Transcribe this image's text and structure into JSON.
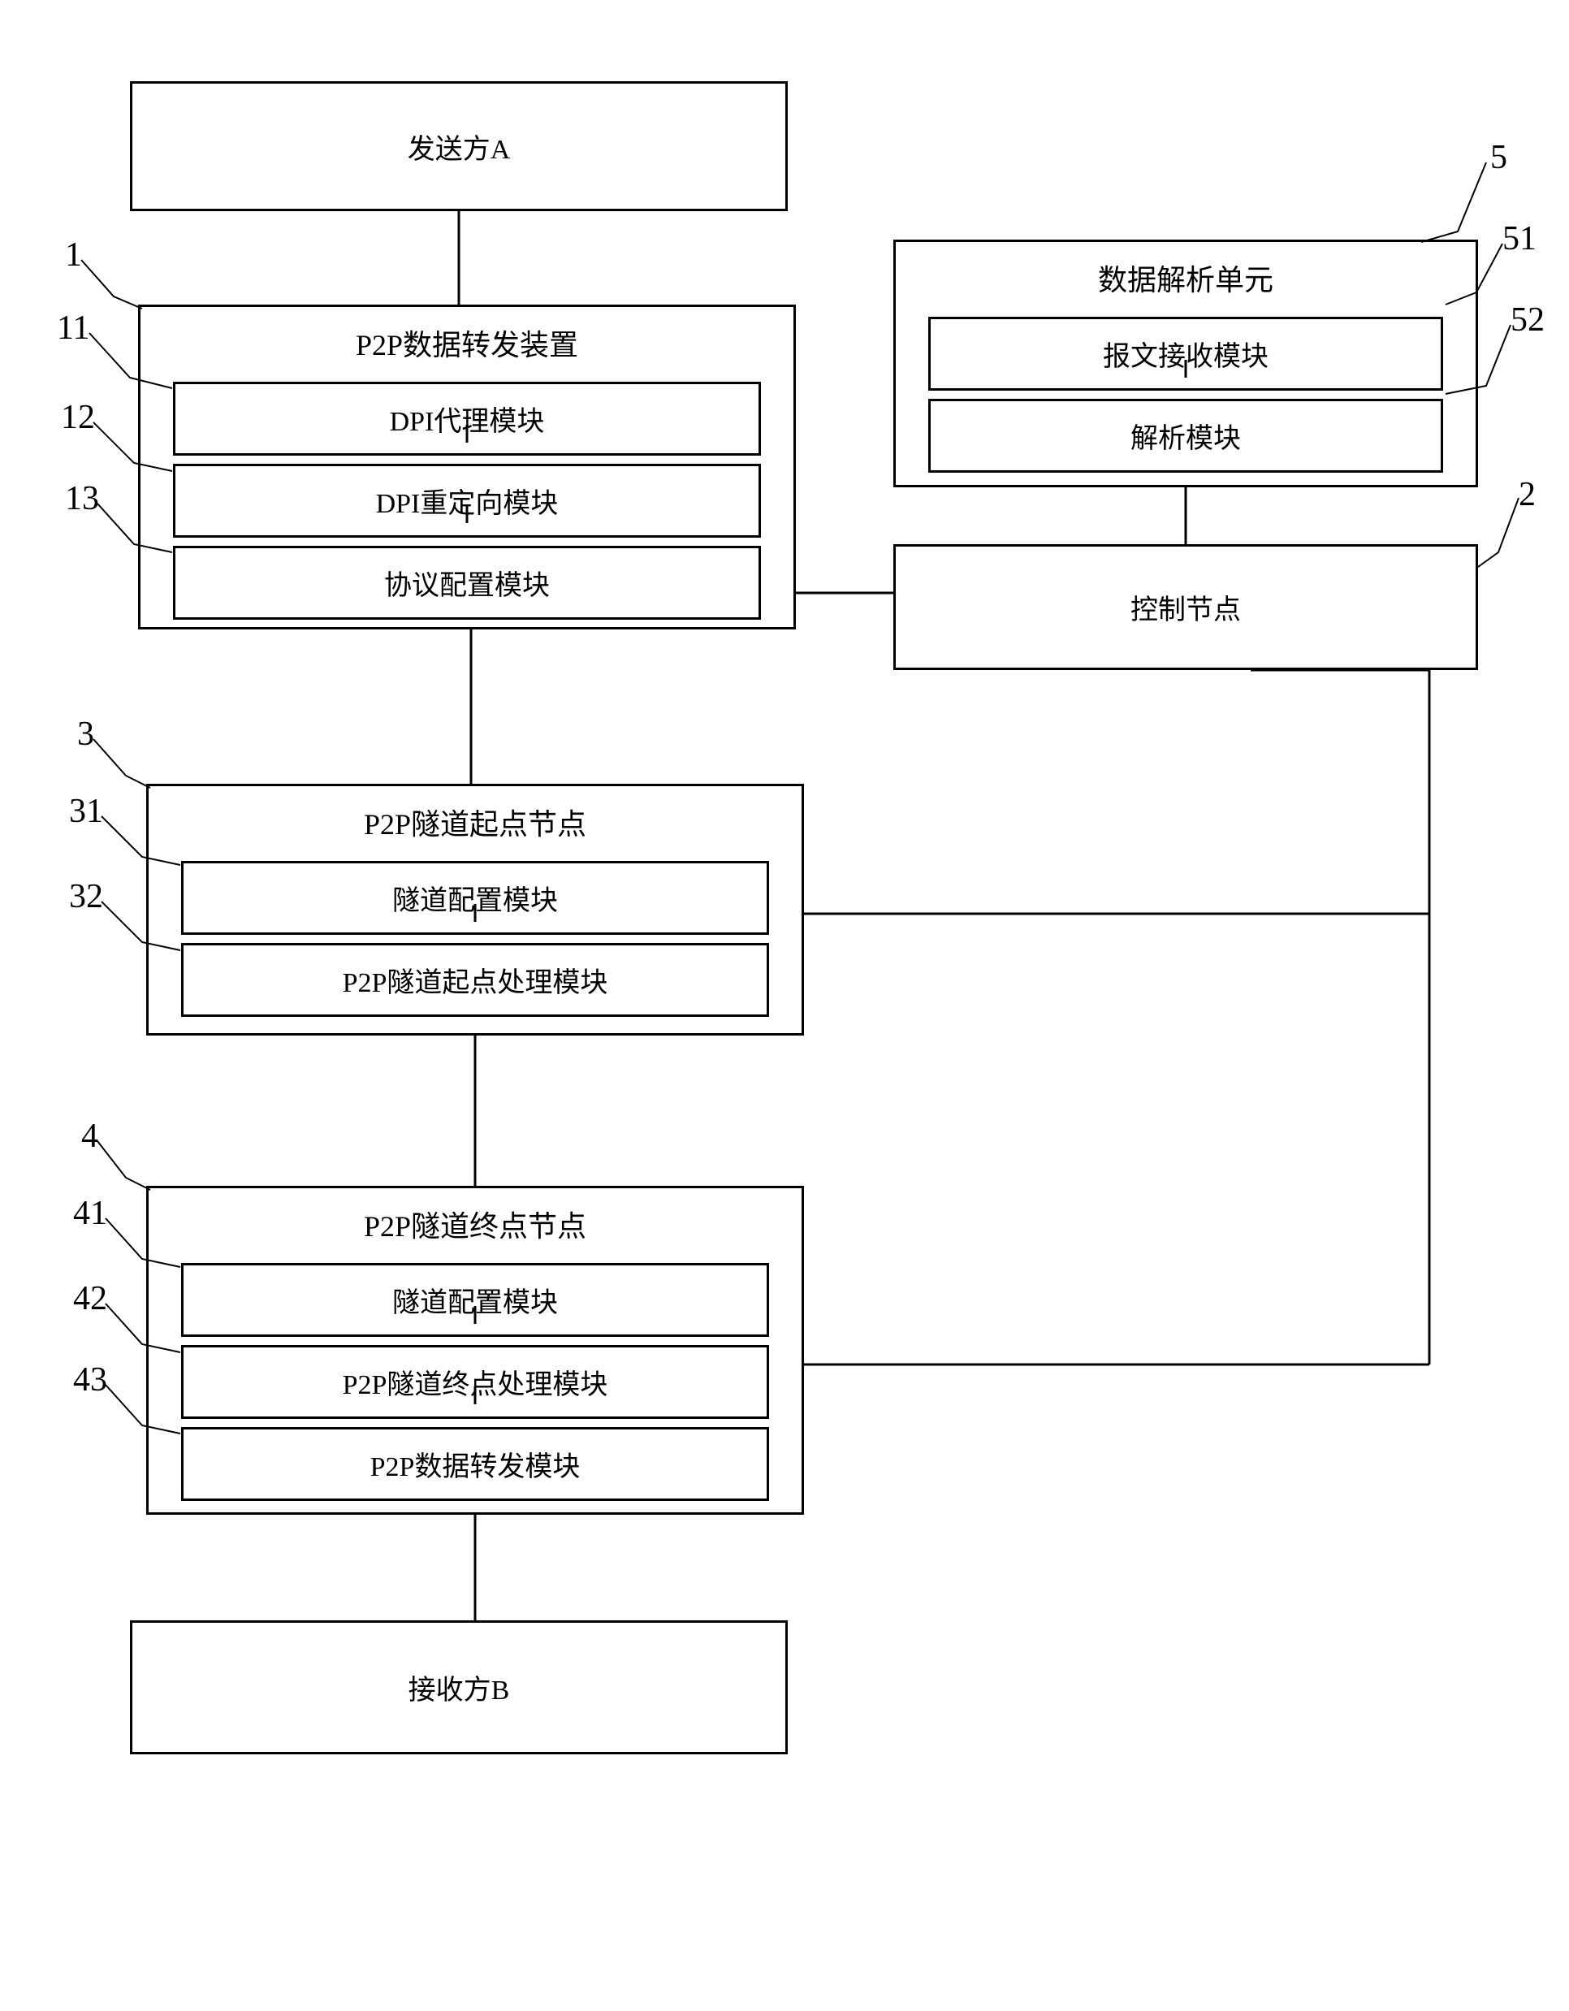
{
  "sender": {
    "label": "发送方A"
  },
  "receiver": {
    "label": "接收方B"
  },
  "blocks": {
    "p2p_forward": {
      "title": "P2P数据转发装置",
      "num": "1",
      "modules": {
        "dpi_proxy": {
          "label": "DPI代理模块",
          "num": "11"
        },
        "dpi_redirect": {
          "label": "DPI重定向模块",
          "num": "12"
        },
        "protocol_config": {
          "label": "协议配置模块",
          "num": "13"
        }
      }
    },
    "data_parse": {
      "title": "数据解析单元",
      "num": "5",
      "modules": {
        "msg_receive": {
          "label": "报文接收模块",
          "num": "51"
        },
        "parse": {
          "label": "解析模块",
          "num": "52"
        }
      }
    },
    "control_node": {
      "title": "控制节点",
      "num": "2"
    },
    "tunnel_start": {
      "title": "P2P隧道起点节点",
      "num": "3",
      "modules": {
        "tunnel_config": {
          "label": "隧道配置模块",
          "num": "31"
        },
        "tunnel_start_proc": {
          "label": "P2P隧道起点处理模块",
          "num": "32"
        }
      }
    },
    "tunnel_end": {
      "title": "P2P隧道终点节点",
      "num": "4",
      "modules": {
        "tunnel_config": {
          "label": "隧道配置模块",
          "num": "41"
        },
        "tunnel_end_proc": {
          "label": "P2P隧道终点处理模块",
          "num": "42"
        },
        "p2p_data_forward": {
          "label": "P2P数据转发模块",
          "num": "43"
        }
      }
    }
  }
}
